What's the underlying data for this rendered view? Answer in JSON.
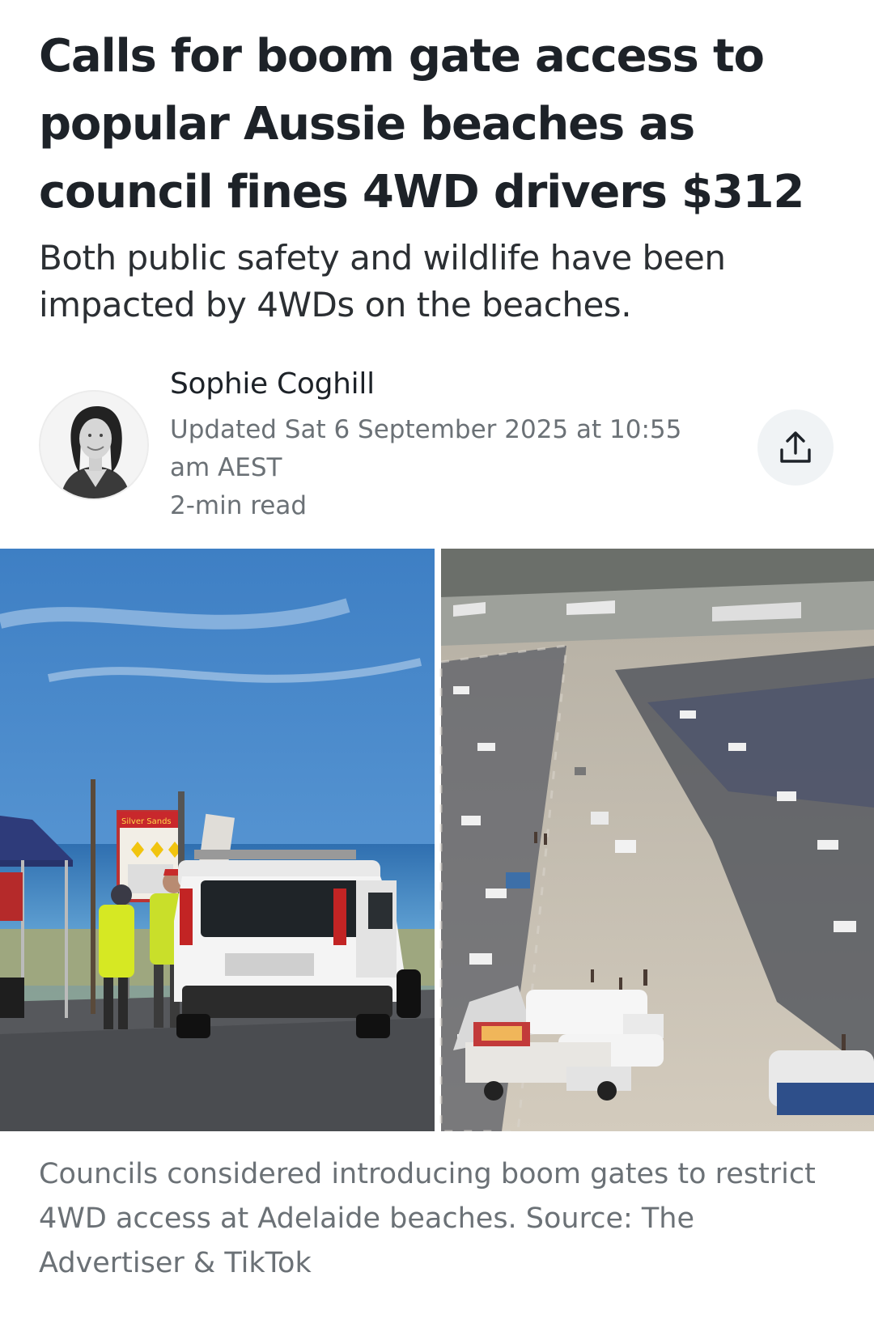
{
  "article": {
    "headline": "Calls for boom gate access to popular Aussie beaches as council fines 4WD drivers $312",
    "subheadline": "Both public safety and wildlife have been impacted by 4WDs on the beaches.",
    "author": {
      "name": "Sophie Coghill",
      "updated": "Updated Sat 6 September 2025 at 10:55 am AEST",
      "read_time": "2-min read"
    },
    "share_icon": "share-upload-icon",
    "image": {
      "left_sign_text": "Silver Sands",
      "caption": "Councils considered introducing boom gates to restrict 4WD access at Adelaide beaches. Source: The Advertiser & TikTok"
    }
  },
  "colors": {
    "headline": "#1d2228",
    "meta": "#6b7176",
    "share_bg": "#f0f3f5"
  }
}
